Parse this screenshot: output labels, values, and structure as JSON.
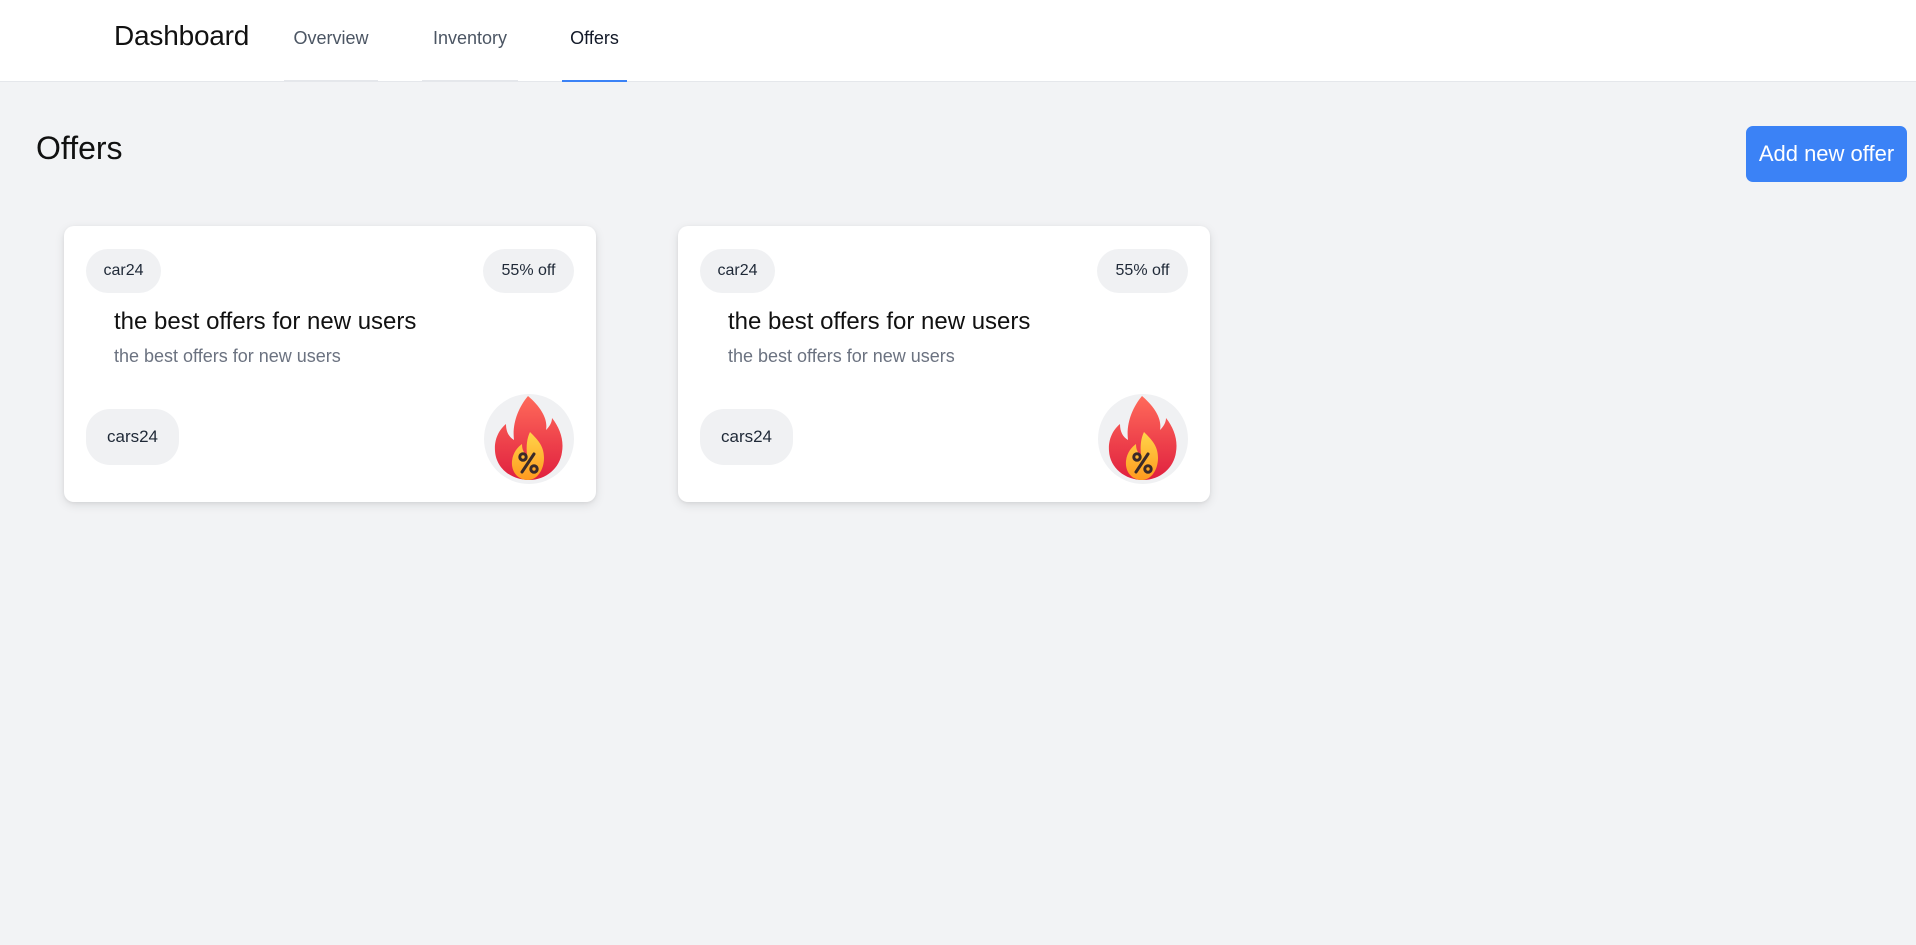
{
  "header": {
    "brand": "Dashboard",
    "tabs": [
      {
        "label": "Overview",
        "active": false
      },
      {
        "label": "Inventory",
        "active": false
      },
      {
        "label": "Offers",
        "active": true
      }
    ]
  },
  "page": {
    "title": "Offers",
    "add_button_label": "Add new offer"
  },
  "offers": [
    {
      "brand": "car24",
      "discount": "55% off",
      "title": "the best offers for new users",
      "description": "the best offers for new users",
      "tag": "cars24",
      "icon": "fire-percent-icon"
    },
    {
      "brand": "car24",
      "discount": "55% off",
      "title": "the best offers for new users",
      "description": "the best offers for new users",
      "tag": "cars24",
      "icon": "fire-percent-icon"
    }
  ],
  "colors": {
    "accent": "#3b82f6",
    "background": "#f2f3f5",
    "pill": "#f0f1f3"
  }
}
